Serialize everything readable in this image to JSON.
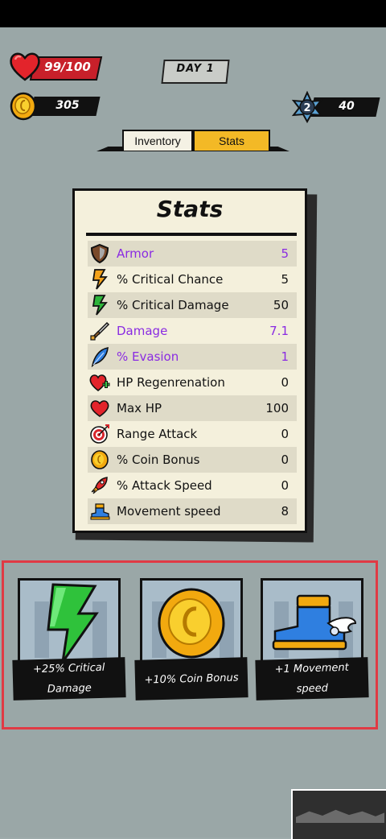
{
  "hud": {
    "hp": "99/100",
    "coins": "305",
    "day": "DAY 1",
    "level": "2",
    "level_points": "40"
  },
  "tabs": [
    {
      "label": "Inventory",
      "active": false
    },
    {
      "label": "Stats",
      "active": true
    }
  ],
  "stats_panel": {
    "title": "Stats",
    "rows": [
      {
        "icon": "shield-icon",
        "label": "Armor",
        "value": "5",
        "highlight": true
      },
      {
        "icon": "lightning-orange-icon",
        "label": "% Critical Chance",
        "value": "5",
        "highlight": false
      },
      {
        "icon": "lightning-green-icon",
        "label": "% Critical Damage",
        "value": "50",
        "highlight": false
      },
      {
        "icon": "sword-icon",
        "label": "Damage",
        "value": "7.1",
        "highlight": true
      },
      {
        "icon": "feather-icon",
        "label": "% Evasion",
        "value": "1",
        "highlight": true
      },
      {
        "icon": "heart-plus-icon",
        "label": "HP Regenrenation",
        "value": "0",
        "highlight": false
      },
      {
        "icon": "heart-icon",
        "label": "Max HP",
        "value": "100",
        "highlight": false
      },
      {
        "icon": "target-icon",
        "label": "Range Attack",
        "value": "0",
        "highlight": false
      },
      {
        "icon": "coin-icon",
        "label": "% Coin Bonus",
        "value": "0",
        "highlight": false
      },
      {
        "icon": "rocket-icon",
        "label": "% Attack Speed",
        "value": "0",
        "highlight": false
      },
      {
        "icon": "boot-icon",
        "label": "Movement speed",
        "value": "8",
        "highlight": false
      }
    ]
  },
  "upgrade_cards": [
    {
      "icon": "lightning-green-icon",
      "line1": "+25% Critical",
      "line2": "Damage"
    },
    {
      "icon": "coin-icon",
      "line1": "+10% Coin Bonus",
      "line2": ""
    },
    {
      "icon": "winged-boot-icon",
      "line1": "+1 Movement",
      "line2": "speed"
    }
  ],
  "colors": {
    "highlight_border": "#e03a44",
    "purple_text": "#8a2be2",
    "active_tab": "#f3b926",
    "hp_bar": "#c8202a"
  }
}
